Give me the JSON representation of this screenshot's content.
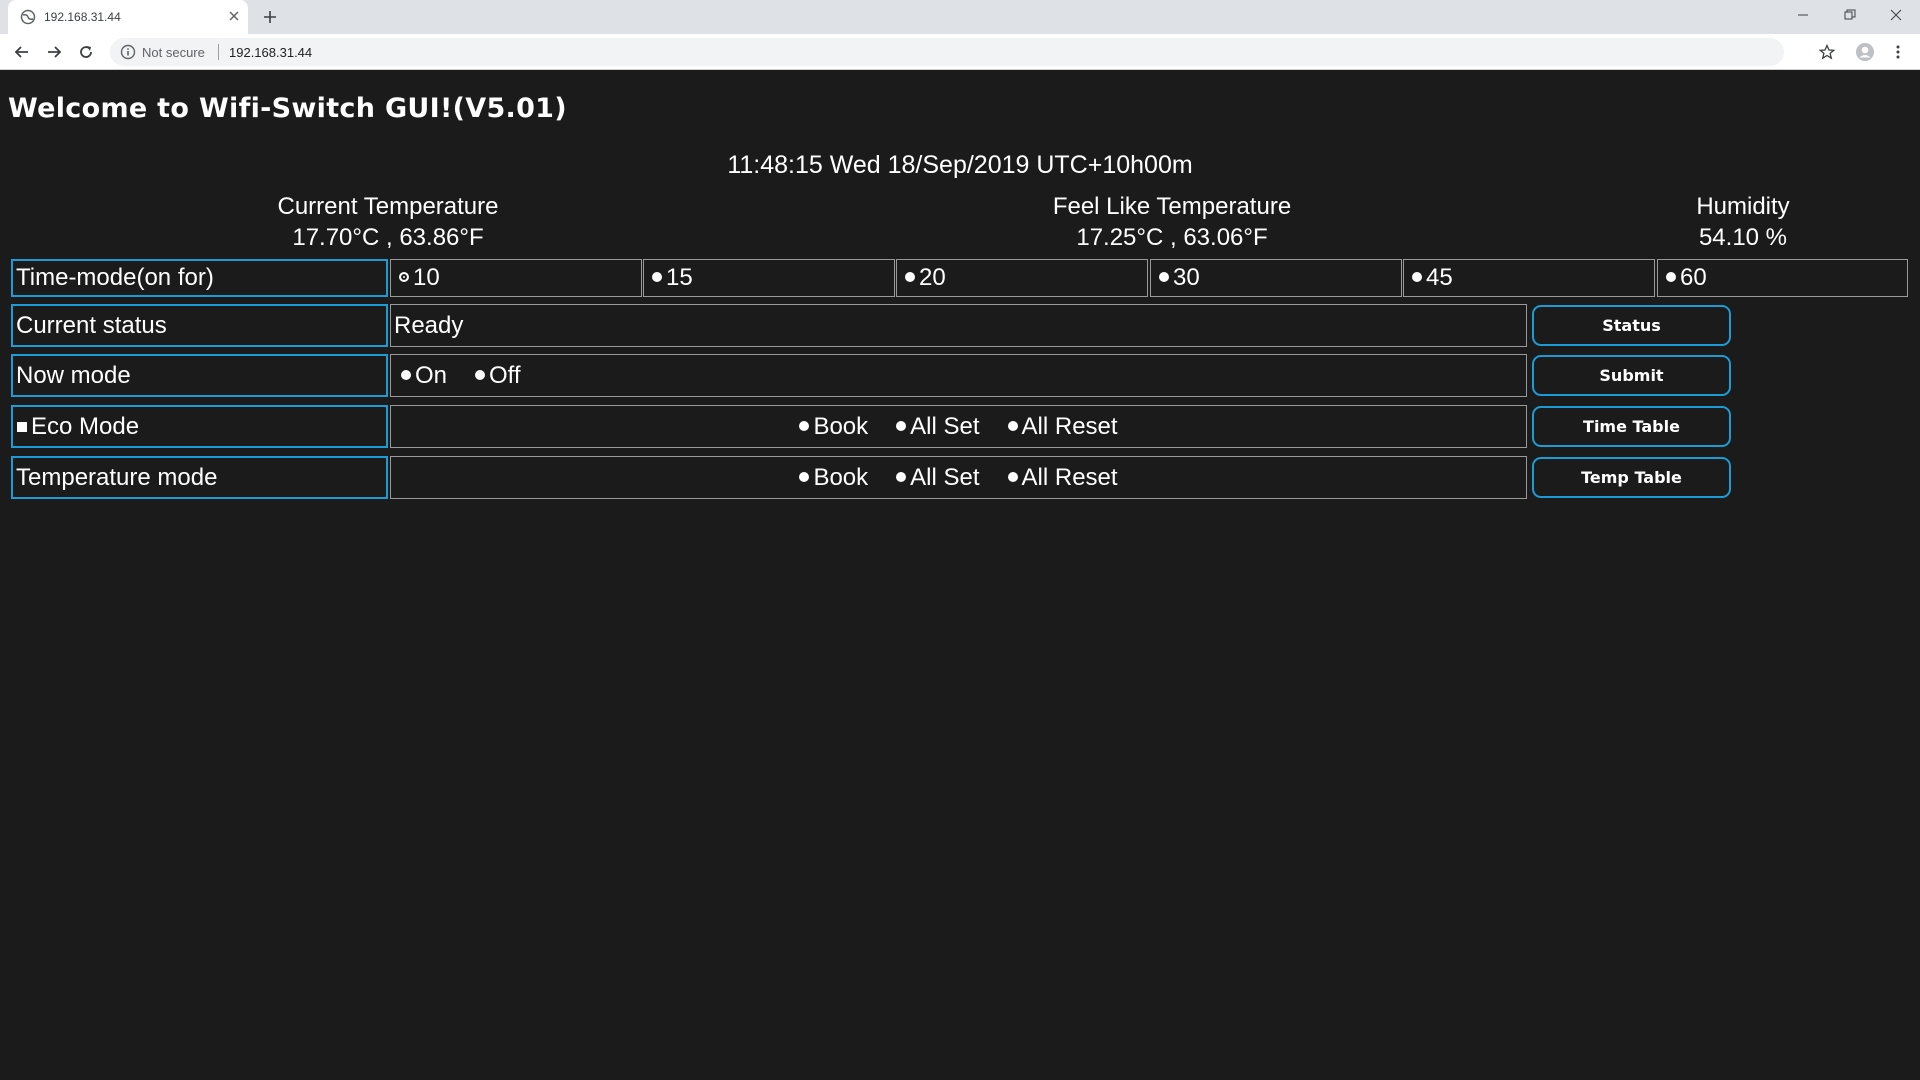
{
  "browser": {
    "tab_title": "192.168.31.44",
    "not_secure_label": "Not secure",
    "url": "192.168.31.44"
  },
  "page": {
    "title": "Welcome to Wifi-Switch GUI!(V5.01)",
    "datetime": "11:48:15 Wed 18/Sep/2019  UTC+10h00m",
    "current_temperature": {
      "label": "Current Temperature",
      "value": "17.70°C , 63.86°F"
    },
    "feel_like_temperature": {
      "label": "Feel Like Temperature",
      "value": "17.25°C , 63.06°F"
    },
    "humidity": {
      "label": "Humidity",
      "value": "54.10 %"
    }
  },
  "time_mode": {
    "label": "Time-mode(on for)",
    "options": [
      "10",
      "15",
      "20",
      "30",
      "45",
      "60"
    ],
    "selected": "10"
  },
  "current_status": {
    "label": "Current status",
    "value": "Ready",
    "button": "Status"
  },
  "now_mode": {
    "label": "Now mode",
    "options": [
      "On",
      "Off"
    ],
    "button": "Submit"
  },
  "eco_mode": {
    "label": "Eco Mode",
    "checked": true,
    "options": [
      "Book",
      "All Set",
      "All Reset"
    ],
    "button": "Time Table"
  },
  "temperature_mode": {
    "label": "Temperature mode",
    "options": [
      "Book",
      "All Set",
      "All Reset"
    ],
    "button": "Temp Table"
  }
}
